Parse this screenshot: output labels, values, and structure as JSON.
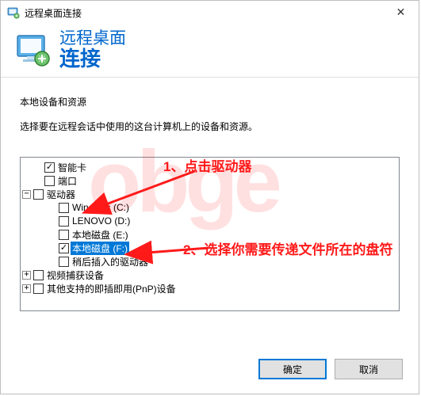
{
  "titlebar": {
    "title": "远程桌面连接",
    "close_glyph": "✕"
  },
  "header": {
    "title": "远程桌面",
    "subtitle": "连接"
  },
  "section": {
    "label": "本地设备和资源",
    "desc": "选择要在远程会话中使用的这台计算机上的设备和资源。"
  },
  "tree": {
    "smartcard": "智能卡",
    "port": "端口",
    "drives": "驱动器",
    "drive_c": "Windows (C:)",
    "drive_d": "LENOVO (D:)",
    "drive_e": "本地磁盘 (E:)",
    "drive_f": "本地磁盘 (F:)",
    "later": "稍后插入的驱动器",
    "video": "视频捕获设备",
    "pnp": "其他支持的即插即用(PnP)设备"
  },
  "buttons": {
    "ok": "确定",
    "cancel": "取消"
  },
  "annotations": {
    "note1": "1、点击驱动器",
    "note2": "2、选择你需要传递文件所在的盘符"
  },
  "watermark": "obge"
}
